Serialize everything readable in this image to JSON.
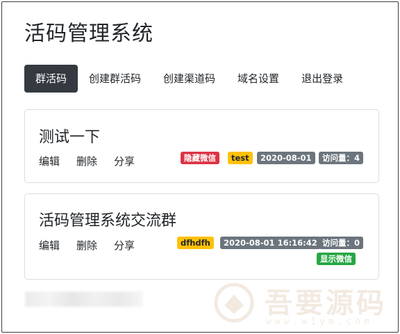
{
  "app": {
    "title": "活码管理系统"
  },
  "nav": {
    "items": [
      {
        "label": "群活码",
        "active": true
      },
      {
        "label": "创建群活码",
        "active": false
      },
      {
        "label": "创建渠道码",
        "active": false
      },
      {
        "label": "域名设置",
        "active": false
      },
      {
        "label": "退出登录",
        "active": false
      }
    ]
  },
  "groups": [
    {
      "title": "测试一下",
      "actions": {
        "edit": "编辑",
        "delete": "删除",
        "share": "分享"
      },
      "wechat_status": "隐藏微信",
      "tag": "test",
      "date": "2020-08-01",
      "visits": "访问量：4"
    },
    {
      "title": "活码管理系统交流群",
      "actions": {
        "edit": "编辑",
        "delete": "删除",
        "share": "分享"
      },
      "tag": "dfhdfh",
      "date": "2020-08-01 16:16:42",
      "visits": "访问量：0",
      "wechat_status": "显示微信"
    }
  ],
  "watermark": {
    "text": "吾要源码",
    "url": "www.w1ym.com"
  },
  "colors": {
    "nav_active_bg": "#343a40",
    "badge_danger": "#dc3545",
    "badge_warning": "#ffc107",
    "badge_secondary": "#6c757d",
    "badge_success": "#28a745"
  }
}
